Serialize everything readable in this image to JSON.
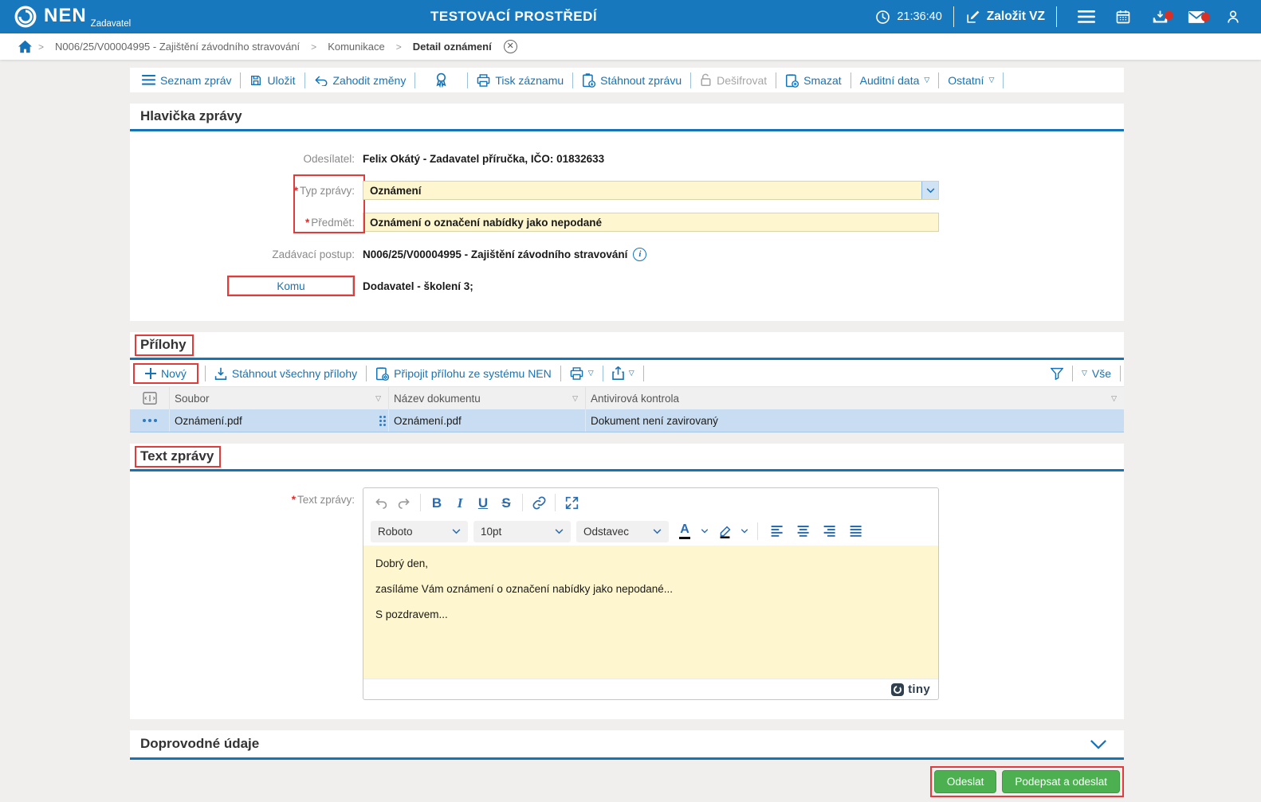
{
  "colors": {
    "topbar_blue": "#1778be",
    "accent_blue": "#1673b8",
    "section_bar_blue": "#1673b4",
    "field_yellow": "#fdf6ce",
    "selected_row_blue": "#c9ddf2",
    "annotation_red": "#e23b3b",
    "button_green": "#4caf50",
    "badge_red": "#d93025"
  },
  "required_mark": "*",
  "topbar": {
    "logo": "NEN",
    "logo_sub": "Zadavatel",
    "env_title": "TESTOVACÍ PROSTŘEDÍ",
    "time": "21:36:40",
    "zalozit_vz": "Založit VZ"
  },
  "breadcrumb": {
    "items": [
      "N006/25/V00004995 - Zajištění závodního stravování",
      "Komunikace",
      "Detail oznámení"
    ]
  },
  "actionbar": {
    "seznam": "Seznam zpráv",
    "ulozit": "Uložit",
    "zahodit": "Zahodit změny",
    "tisk": "Tisk záznamu",
    "stahnout": "Stáhnout zprávu",
    "desifrovat": "Dešifrovat",
    "smazat": "Smazat",
    "auditni": "Auditní data",
    "ostatni": "Ostatní"
  },
  "hlavicka": {
    "title": "Hlavička zprávy",
    "odesilatel_label": "Odesílatel:",
    "odesilatel_value": "Felix Okátý - Zadavatel příručka, IČO: 01832633",
    "typ_label": "Typ zprávy:",
    "typ_value": "Oznámení",
    "predmet_label": "Předmět:",
    "predmet_value": "Oznámení o označení nabídky jako nepodané",
    "postup_label": "Zadávací postup:",
    "postup_value": "N006/25/V00004995 - Zajištění závodního stravování",
    "komu_label": "Komu",
    "komu_value": "Dodavatel - školení 3;"
  },
  "prilohy": {
    "title": "Přílohy",
    "novy": "Nový",
    "stahnout_vse": "Stáhnout všechny přílohy",
    "pripojit": "Připojit přílohu ze systému NEN",
    "vse": "Vše",
    "columns": [
      "Soubor",
      "Název dokumentu",
      "Antivirová kontrola"
    ],
    "rows": [
      {
        "soubor": "Oznámení.pdf",
        "nazev": "Oznámení.pdf",
        "antivirus": "Dokument není zavirovaný"
      }
    ]
  },
  "text_zpravy": {
    "title": "Text zprávy",
    "label": "Text zprávy:",
    "font_select": "Roboto",
    "size_select": "10pt",
    "block_select": "Odstavec",
    "lines": [
      "Dobrý den,",
      "zasíláme Vám oznámení o označení nabídky jako nepodané...",
      "S pozdravem..."
    ],
    "editor_brand": "tiny"
  },
  "doprovodne": {
    "title": "Doprovodné údaje"
  },
  "footer_buttons": {
    "odeslat": "Odeslat",
    "podepsat": "Podepsat a odeslat"
  }
}
